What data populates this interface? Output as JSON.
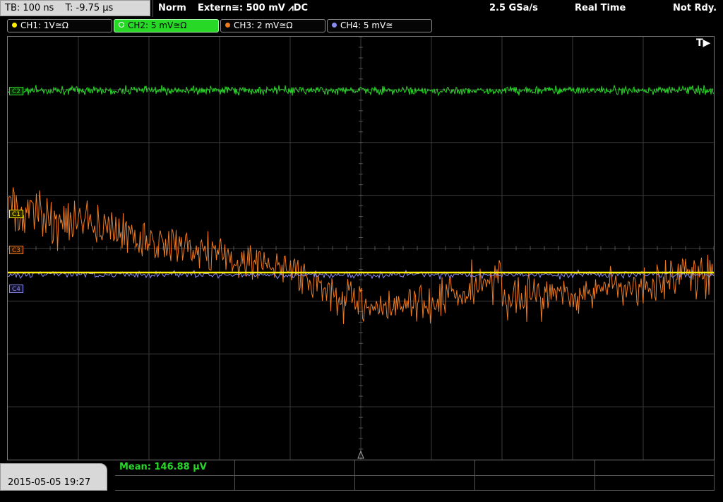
{
  "header": {
    "timebase": "TB: 100 ns",
    "trigger_time": "T: -9.75 µs",
    "mode": "Norm",
    "trigger_source": "Extern≅: 500 mV ⩘DC",
    "sample_rate": "2.5 GSa/s",
    "acq_mode": "Real Time",
    "status": "Not Rdy."
  },
  "channels": [
    {
      "label": "CH1: 1V≅Ω",
      "color": "#ffee00"
    },
    {
      "label": "CH2: 5 mV≅Ω",
      "color": "#27d827"
    },
    {
      "label": "CH3: 2 mV≅Ω",
      "color": "#f07a20"
    },
    {
      "label": "CH4: 5 mV≅",
      "color": "#8c8cf0"
    }
  ],
  "markers": {
    "c2": "C2",
    "c1": "C1",
    "c3": "C3",
    "c4": "C4"
  },
  "trigger_indicator": "T▶",
  "footer": {
    "datetime": "2015-05-05 19:27",
    "mean": "Mean: 146.88 µV"
  },
  "colors": {
    "grid": "#3a3a3a",
    "ch1": "#ffee00",
    "ch2": "#27d827",
    "ch3": "#f07a20",
    "ch4": "#8c8cf0"
  }
}
